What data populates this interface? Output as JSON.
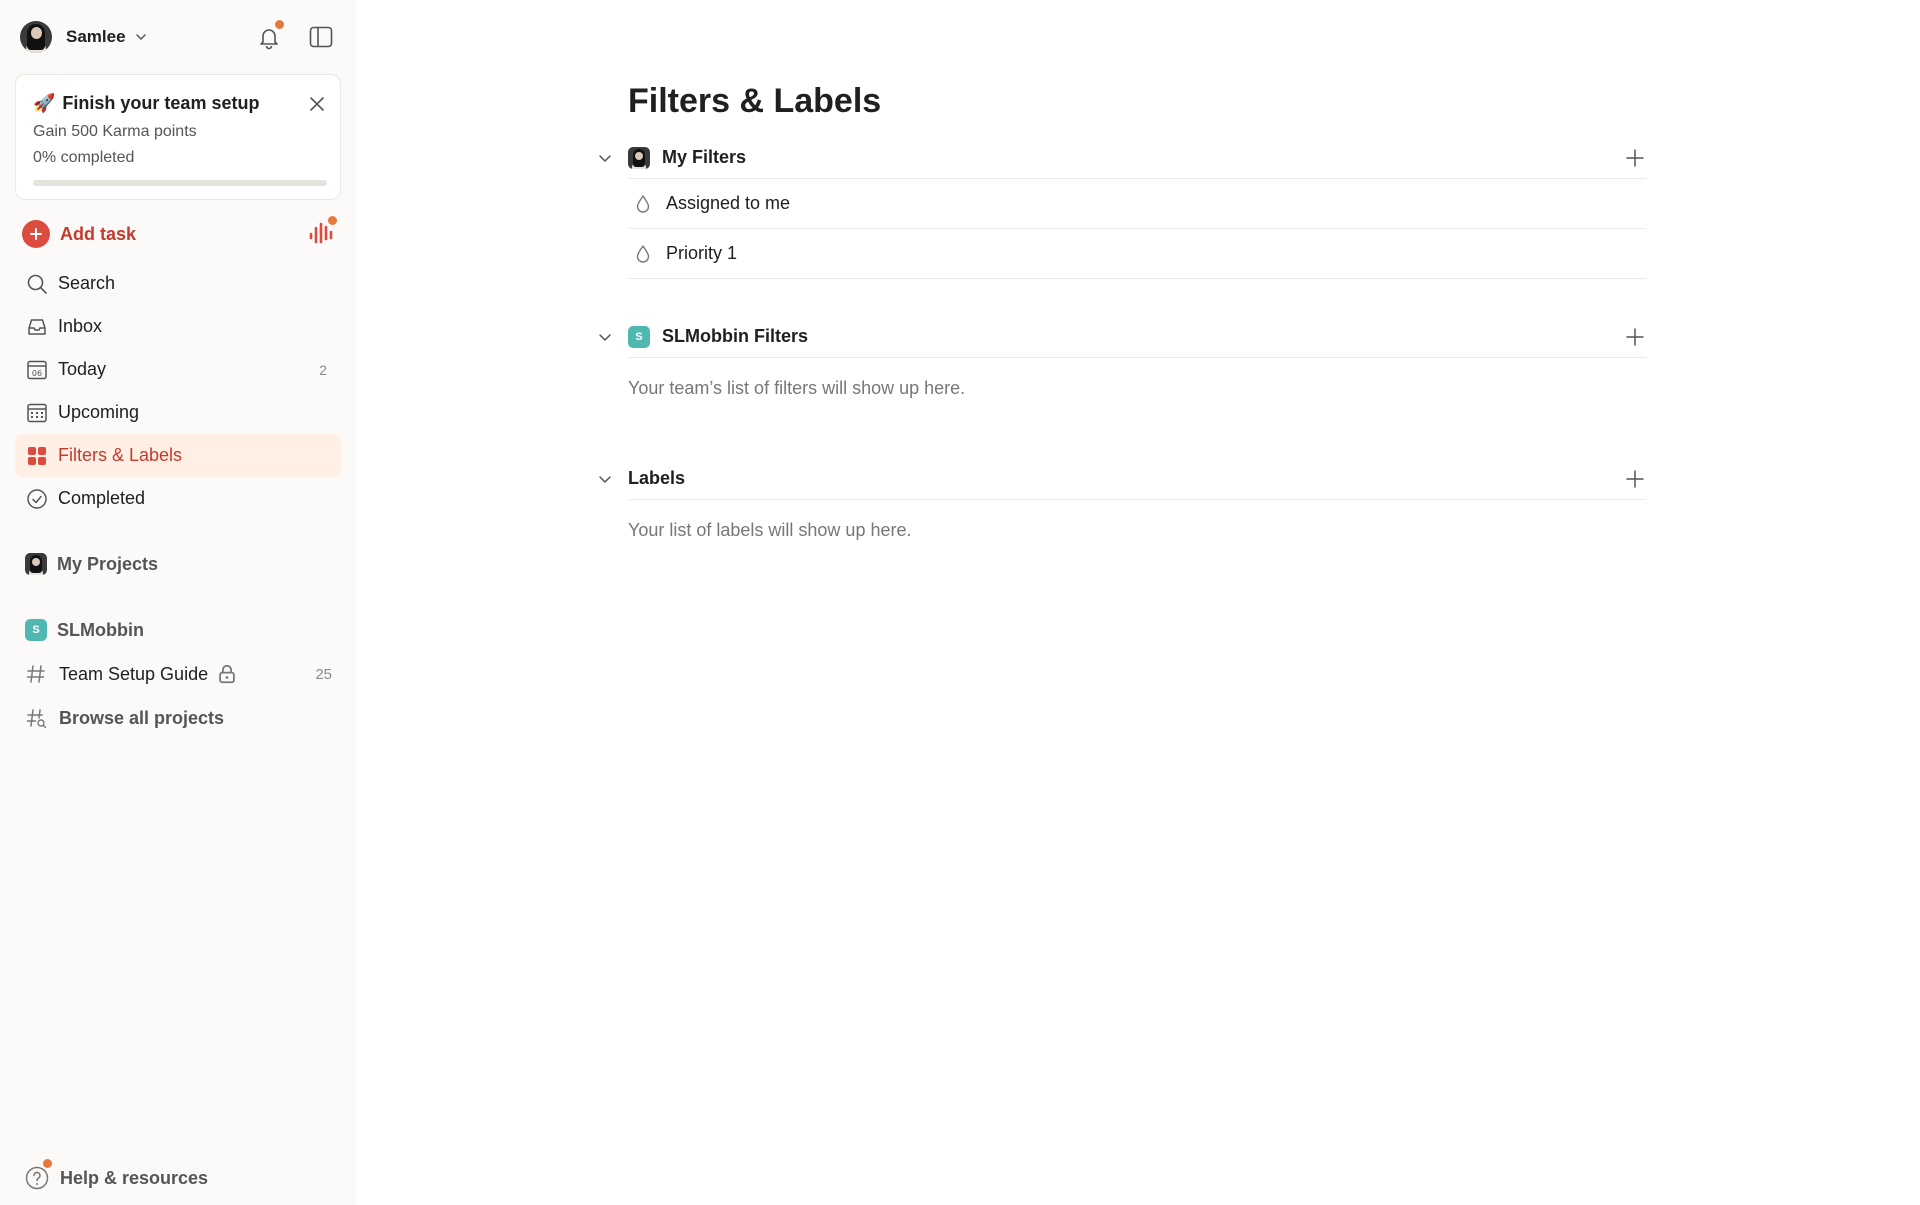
{
  "sidebar": {
    "user_name": "Samlee",
    "setup": {
      "title": "Finish your team setup",
      "subtitle": "Gain 500 Karma points",
      "progress_text": "0% completed",
      "progress": 0
    },
    "add_task_label": "Add task",
    "nav": [
      {
        "label": "Search",
        "icon": "search-icon",
        "count": ""
      },
      {
        "label": "Inbox",
        "icon": "inbox-icon",
        "count": ""
      },
      {
        "label": "Today",
        "icon": "calendar-today-icon",
        "count": "2",
        "day": "06"
      },
      {
        "label": "Upcoming",
        "icon": "calendar-grid-icon",
        "count": ""
      },
      {
        "label": "Filters & Labels",
        "icon": "filters-grid-icon",
        "count": "",
        "active": true
      },
      {
        "label": "Completed",
        "icon": "check-circle-icon",
        "count": ""
      }
    ],
    "my_projects_label": "My Projects",
    "team_label": "SLMobbin",
    "team_badge": "S",
    "projects": [
      {
        "label": "Team Setup Guide",
        "icon": "hash-icon",
        "count": "25",
        "locked": true
      }
    ],
    "browse_label": "Browse all projects",
    "help_label": "Help & resources",
    "colors": {
      "accent": "#dc4c3e",
      "active_bg": "#ffefe5",
      "notification": "#e8793d",
      "team": "#4fb8b1"
    }
  },
  "main": {
    "title": "Filters & Labels",
    "my_filters": {
      "label": "My Filters",
      "items": [
        {
          "label": "Assigned to me"
        },
        {
          "label": "Priority 1"
        }
      ]
    },
    "team_filters": {
      "label": "SLMobbin Filters",
      "badge": "S",
      "empty": "Your team’s list of filters will show up here."
    },
    "labels": {
      "label": "Labels",
      "empty": "Your list of labels will show up here."
    }
  }
}
